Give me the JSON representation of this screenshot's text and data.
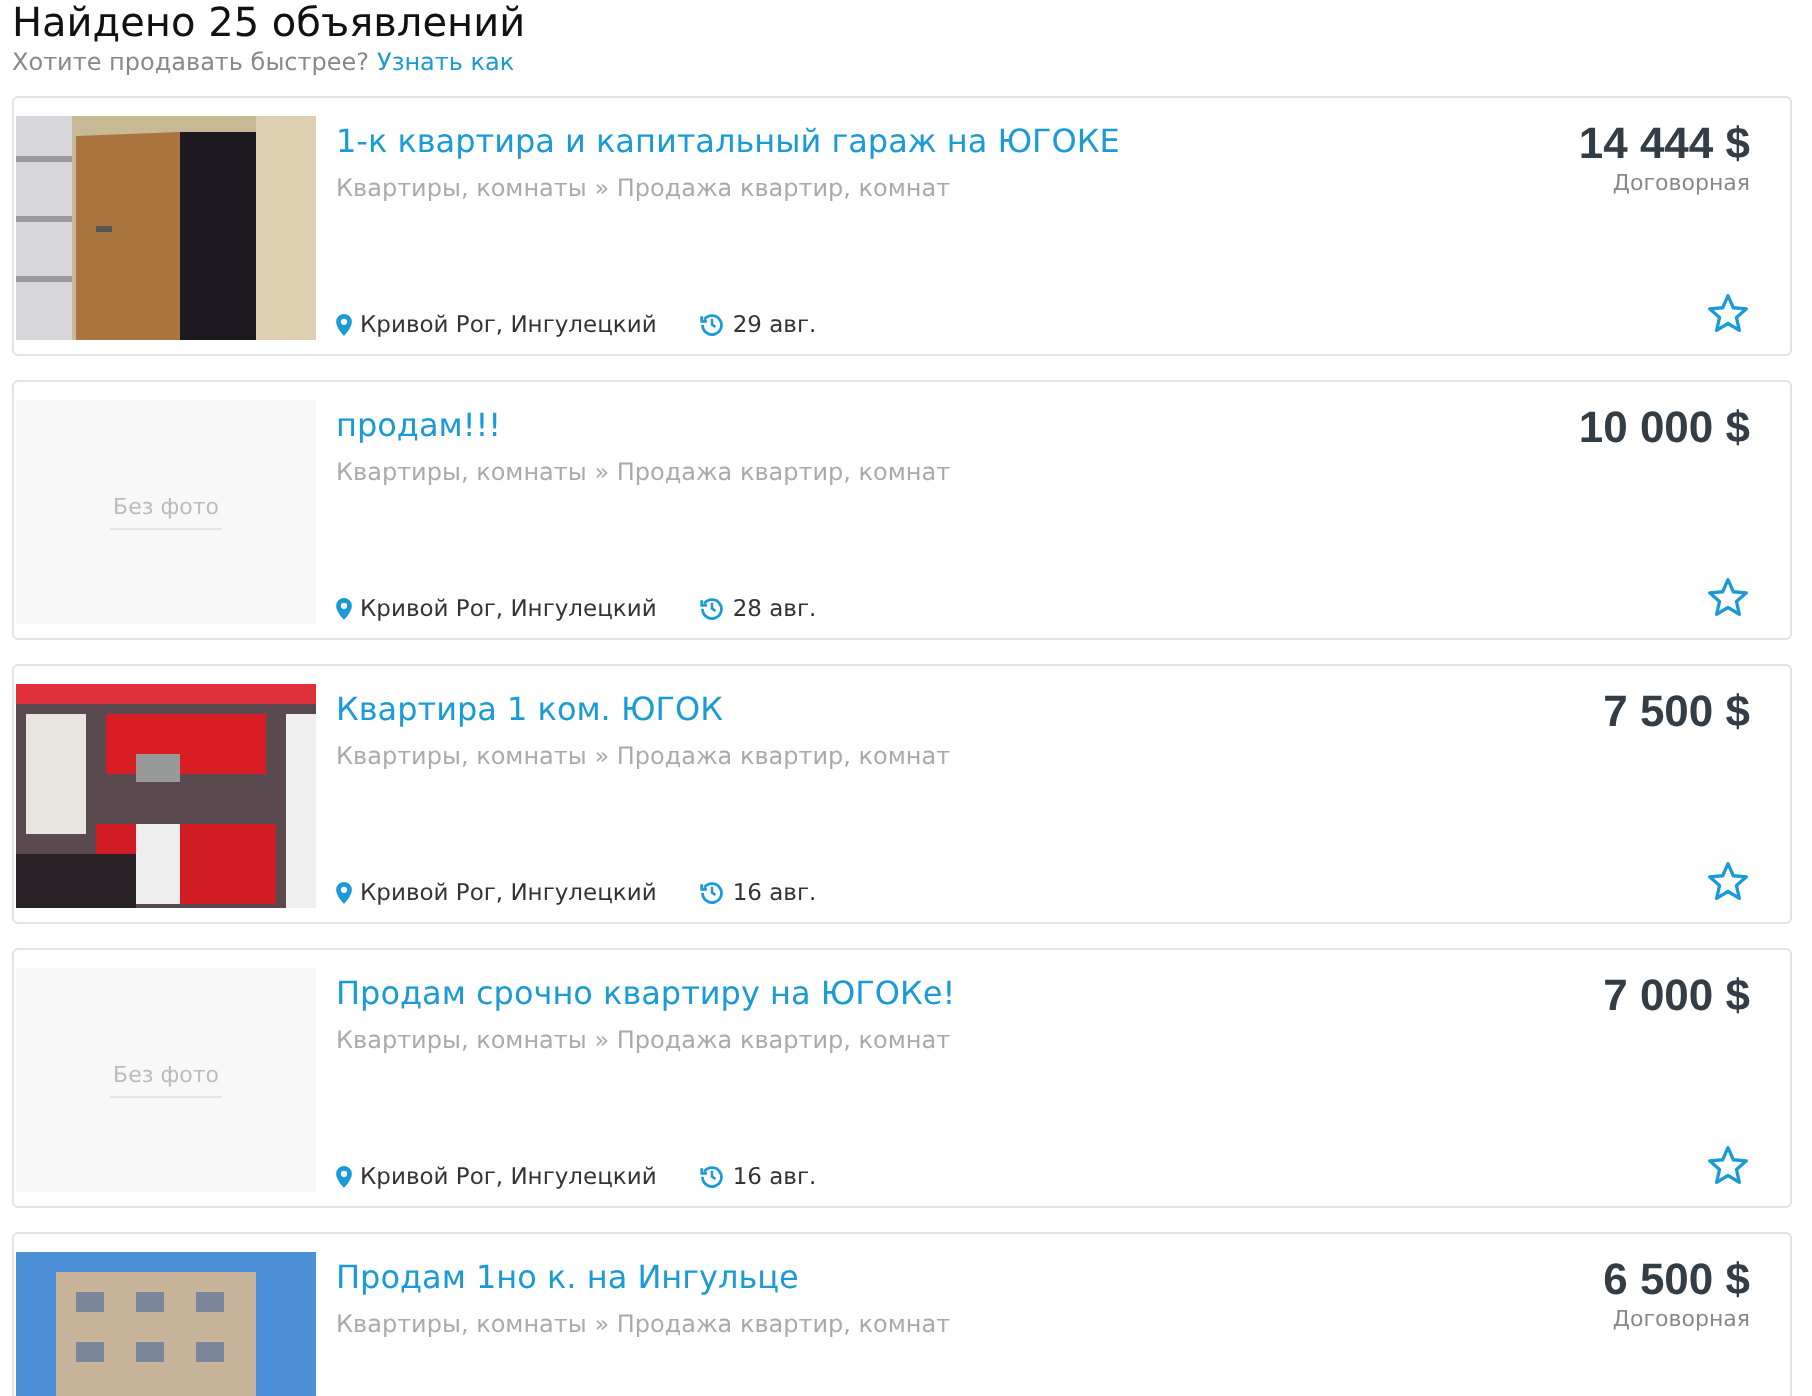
{
  "header": {
    "title": "Найдено 25 объявлений",
    "hint": "Хотите продавать быстрее?",
    "hint_link": "Узнать как"
  },
  "listings": [
    {
      "title": "1-к квартира и капитальный гараж на ЮГОКЕ",
      "category": "Квартиры, комнаты » Продажа квартир, комнат",
      "price": "14 444 $",
      "price_note": "Договорная",
      "location": "Кривой Рог, Ингулецкий",
      "date": "29 авг.",
      "favorite": false
    },
    {
      "image": {
        "kind": "no_photo",
        "label": "Без фото"
      },
      "title": "продам!!!",
      "category": "Квартиры, комнаты » Продажа квартир, комнат",
      "price": "10 000 $",
      "location": "Кривой Рог, Ингулецкий",
      "date": "28 авг.",
      "favorite": false
    },
    {
      "title": "Квартира 1 ком. ЮГОК",
      "category": "Квартиры, комнаты » Продажа квартир, комнат",
      "price": "7 500 $",
      "location": "Кривой Рог, Ингулецкий",
      "date": "16 авг.",
      "favorite": false
    },
    {
      "image": {
        "kind": "no_photo",
        "label": "Без фото"
      },
      "title": "Продам срочно квартиру на ЮГОКе!",
      "category": "Квартиры, комнаты » Продажа квартир, комнат",
      "price": "7 000 $",
      "location": "Кривой Рог, Ингулецкий",
      "date": "16 авг.",
      "favorite": false
    },
    {
      "title": "Продам 1но к. на Ингульце",
      "category": "Квартиры, комнаты » Продажа квартир, комнат",
      "price": "6 500 $",
      "price_note": "Договорная"
    }
  ]
}
